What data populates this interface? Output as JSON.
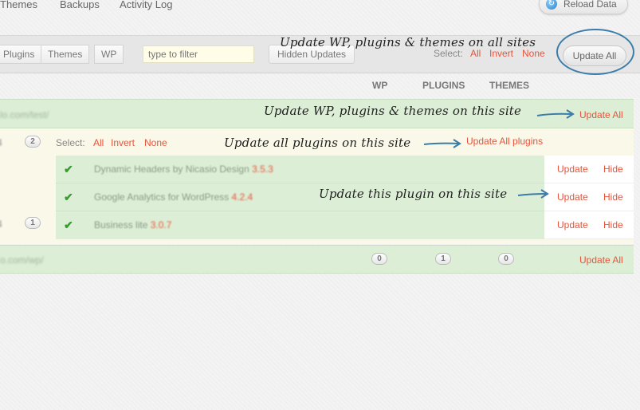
{
  "nav": {
    "links": [
      "Themes",
      "Backups",
      "Activity Log"
    ],
    "reload_label": "Reload Data"
  },
  "filterbar": {
    "tabs": [
      "Plugins",
      "Themes",
      "WP"
    ],
    "filter_placeholder": "type to filter",
    "hidden_updates_label": "Hidden Updates",
    "select_label": "Select:",
    "select_all": "All",
    "select_invert": "Invert",
    "select_none": "None",
    "update_all_label": "Update All"
  },
  "columns": {
    "wp": "WP",
    "plugins": "PLUGINS",
    "themes": "THEMES"
  },
  "site1": {
    "url": "lo.com/test/",
    "update_all": "Update All",
    "panel": {
      "count": "2",
      "select_label": "Select:",
      "select_all": "All",
      "select_invert": "Invert",
      "select_none": "None",
      "update_all_plugins": "Update All plugins"
    },
    "plugins": [
      {
        "name": "Dynamic Headers by Nicasio Design",
        "version": "3.5.3",
        "update": "Update",
        "hide": "Hide"
      },
      {
        "name": "Google Analytics for WordPress",
        "version": "4.2.4",
        "update": "Update",
        "hide": "Hide"
      },
      {
        "name": "Business lite",
        "version": "3.0.7",
        "update": "Update",
        "hide": "Hide"
      }
    ],
    "left_digits": [
      "4",
      "4"
    ],
    "second_count": "1"
  },
  "site2": {
    "url": "o.com/wp/",
    "wp_count": "0",
    "plugins_count": "1",
    "themes_count": "0",
    "update_all": "Update All"
  },
  "annotations": {
    "all_sites": "Update WP, plugins & themes on all sites",
    "this_site": "Update WP, plugins & themes on this site",
    "all_plugins": "Update all plugins on this site",
    "this_plugin": "Update this plugin on this site"
  },
  "colors": {
    "accent_link": "#e8543b",
    "row_green": "#dcefd6",
    "panel_cream": "#f9f8e9",
    "annotation_blue": "#3c7ca9"
  }
}
